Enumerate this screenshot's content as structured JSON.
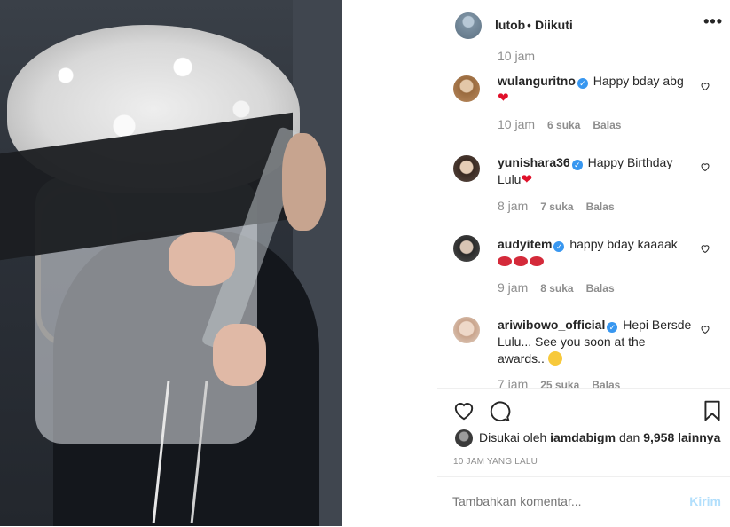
{
  "post": {
    "username": "lutob",
    "separator": "•",
    "follow_status": "Diikuti",
    "more_icon": "more-horizontal-icon"
  },
  "comments": {
    "top_time": "10 jam",
    "items": [
      {
        "user": "wulanguritno",
        "text": "Happy bday abg",
        "emoji": "❤",
        "time": "10 jam",
        "likes": "6 suka",
        "reply": "Balas"
      },
      {
        "user": "yunishara36",
        "text": "Happy Birthday",
        "text2": "Lulu",
        "emoji": "❤",
        "time": "8 jam",
        "likes": "7 suka",
        "reply": "Balas"
      },
      {
        "user": "audyitem",
        "text": "happy bday kaaaak",
        "time": "9 jam",
        "likes": "8 suka",
        "reply": "Balas"
      },
      {
        "user": "ariwibowo_official",
        "text": "Hepi Bersde",
        "text2": "Lulu... See you soon at the",
        "text3": "awards..",
        "time": "7 jam",
        "likes": "25 suka",
        "reply": "Balas"
      }
    ]
  },
  "likes": {
    "prefix": "Disukai oleh",
    "user": "iamdabigm",
    "middle": "dan",
    "count": "9,958 lainnya"
  },
  "timestamp": "10 JAM YANG LALU",
  "add_comment": {
    "placeholder": "Tambahkan komentar...",
    "post_label": "Kirim"
  },
  "colors": {
    "verified": "#3897f0",
    "muted": "#8e8e8e",
    "post_disabled": "#b2dffc"
  }
}
